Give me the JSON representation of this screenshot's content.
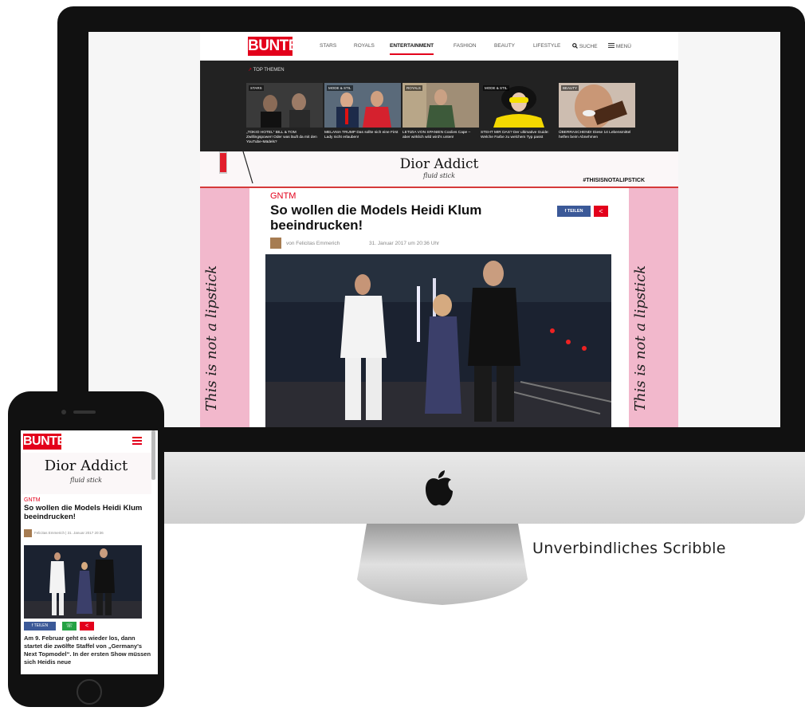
{
  "desktop_site": {
    "logo": "BUNTE",
    "nav": [
      "STARS",
      "ROYALS",
      "ENTERTAINMENT",
      "FASHION",
      "BEAUTY",
      "LIFESTYLE"
    ],
    "nav_active": "ENTERTAINMENT",
    "search_label": "SUCHE",
    "menu_label": "MENÜ",
    "top_themen_label": "TOP THEMEN",
    "top_themen": [
      {
        "category": "STARS",
        "caption": "„TOKIO HOTEL“ BILL & TOM Zwillingspower! Oder was läuft da mit den YouTube-Mädels?"
      },
      {
        "category": "MODE & STIL",
        "caption": "MELANIA TRUMP Das sollte sich eine First Lady nicht erlauben!"
      },
      {
        "category": "ROYALS",
        "caption": "LETIZIA VON SPANIEN Coolies Cape – aber wirklich wild wird's unten!"
      },
      {
        "category": "MODE & STIL",
        "caption": "STEHT MIR DAS? Der ultimative Guide: Welche Farbe zu welchem Typ passt"
      },
      {
        "category": "BEAUTY",
        "caption": "ÜBERRASCHEND! Diese 14 Lebensmittel helfen beim Abnehmen"
      }
    ],
    "ad": {
      "brand": "Dior Addict",
      "tagline": "fluid stick",
      "hashtag": "#THISISNOTALIPSTICK",
      "side_text": "This is not a lipstick"
    },
    "article": {
      "category": "GNTM",
      "title": "So wollen die Models Heidi Klum beeindrucken!",
      "share_label": "TEILEN",
      "author": "von Felicitas Emmerich",
      "date": "31. Januar 2017 um 20:36 Uhr"
    }
  },
  "mobile_site": {
    "logo": "BUNTE",
    "ad": {
      "brand": "Dior Addict",
      "tagline": "fluid stick"
    },
    "category": "GNTM",
    "title": "So wollen die Models Heidi Klum beeindrucken!",
    "meta": "Felicitas Emmerich | 31. Januar 2017 20:36",
    "share_label": "TEILEN",
    "body": "Am 9. Februar geht es wieder los, dann startet die zwölfte Staffel von „Germany's Next Topmodel“. In der ersten Show müssen sich Heidis neue"
  },
  "caption": "Unverbindliches Scribble"
}
